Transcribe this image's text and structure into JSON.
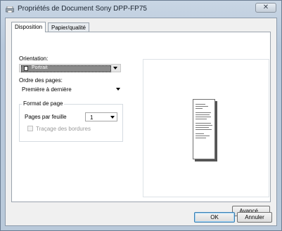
{
  "window": {
    "title": "Propriétés de Document Sony DPP-FP75",
    "close_symbol": "✕"
  },
  "tabs": [
    {
      "label": "Disposition",
      "active": true
    },
    {
      "label": "Papier/qualité",
      "active": false
    }
  ],
  "orientation": {
    "label": "Orientation:",
    "value": "Portrait",
    "icon": "portrait-page-icon"
  },
  "page_order": {
    "label": "Ordre des pages:",
    "value": "Première à dernière"
  },
  "page_format": {
    "group_title": "Format de page",
    "pages_per_sheet_label": "Pages par feuille",
    "pages_per_sheet_value": "1",
    "borders_label": "Traçage des bordures",
    "borders_checked": false,
    "borders_enabled": false
  },
  "buttons": {
    "advanced": "Avancé...",
    "ok": "OK",
    "cancel": "Annuler"
  }
}
